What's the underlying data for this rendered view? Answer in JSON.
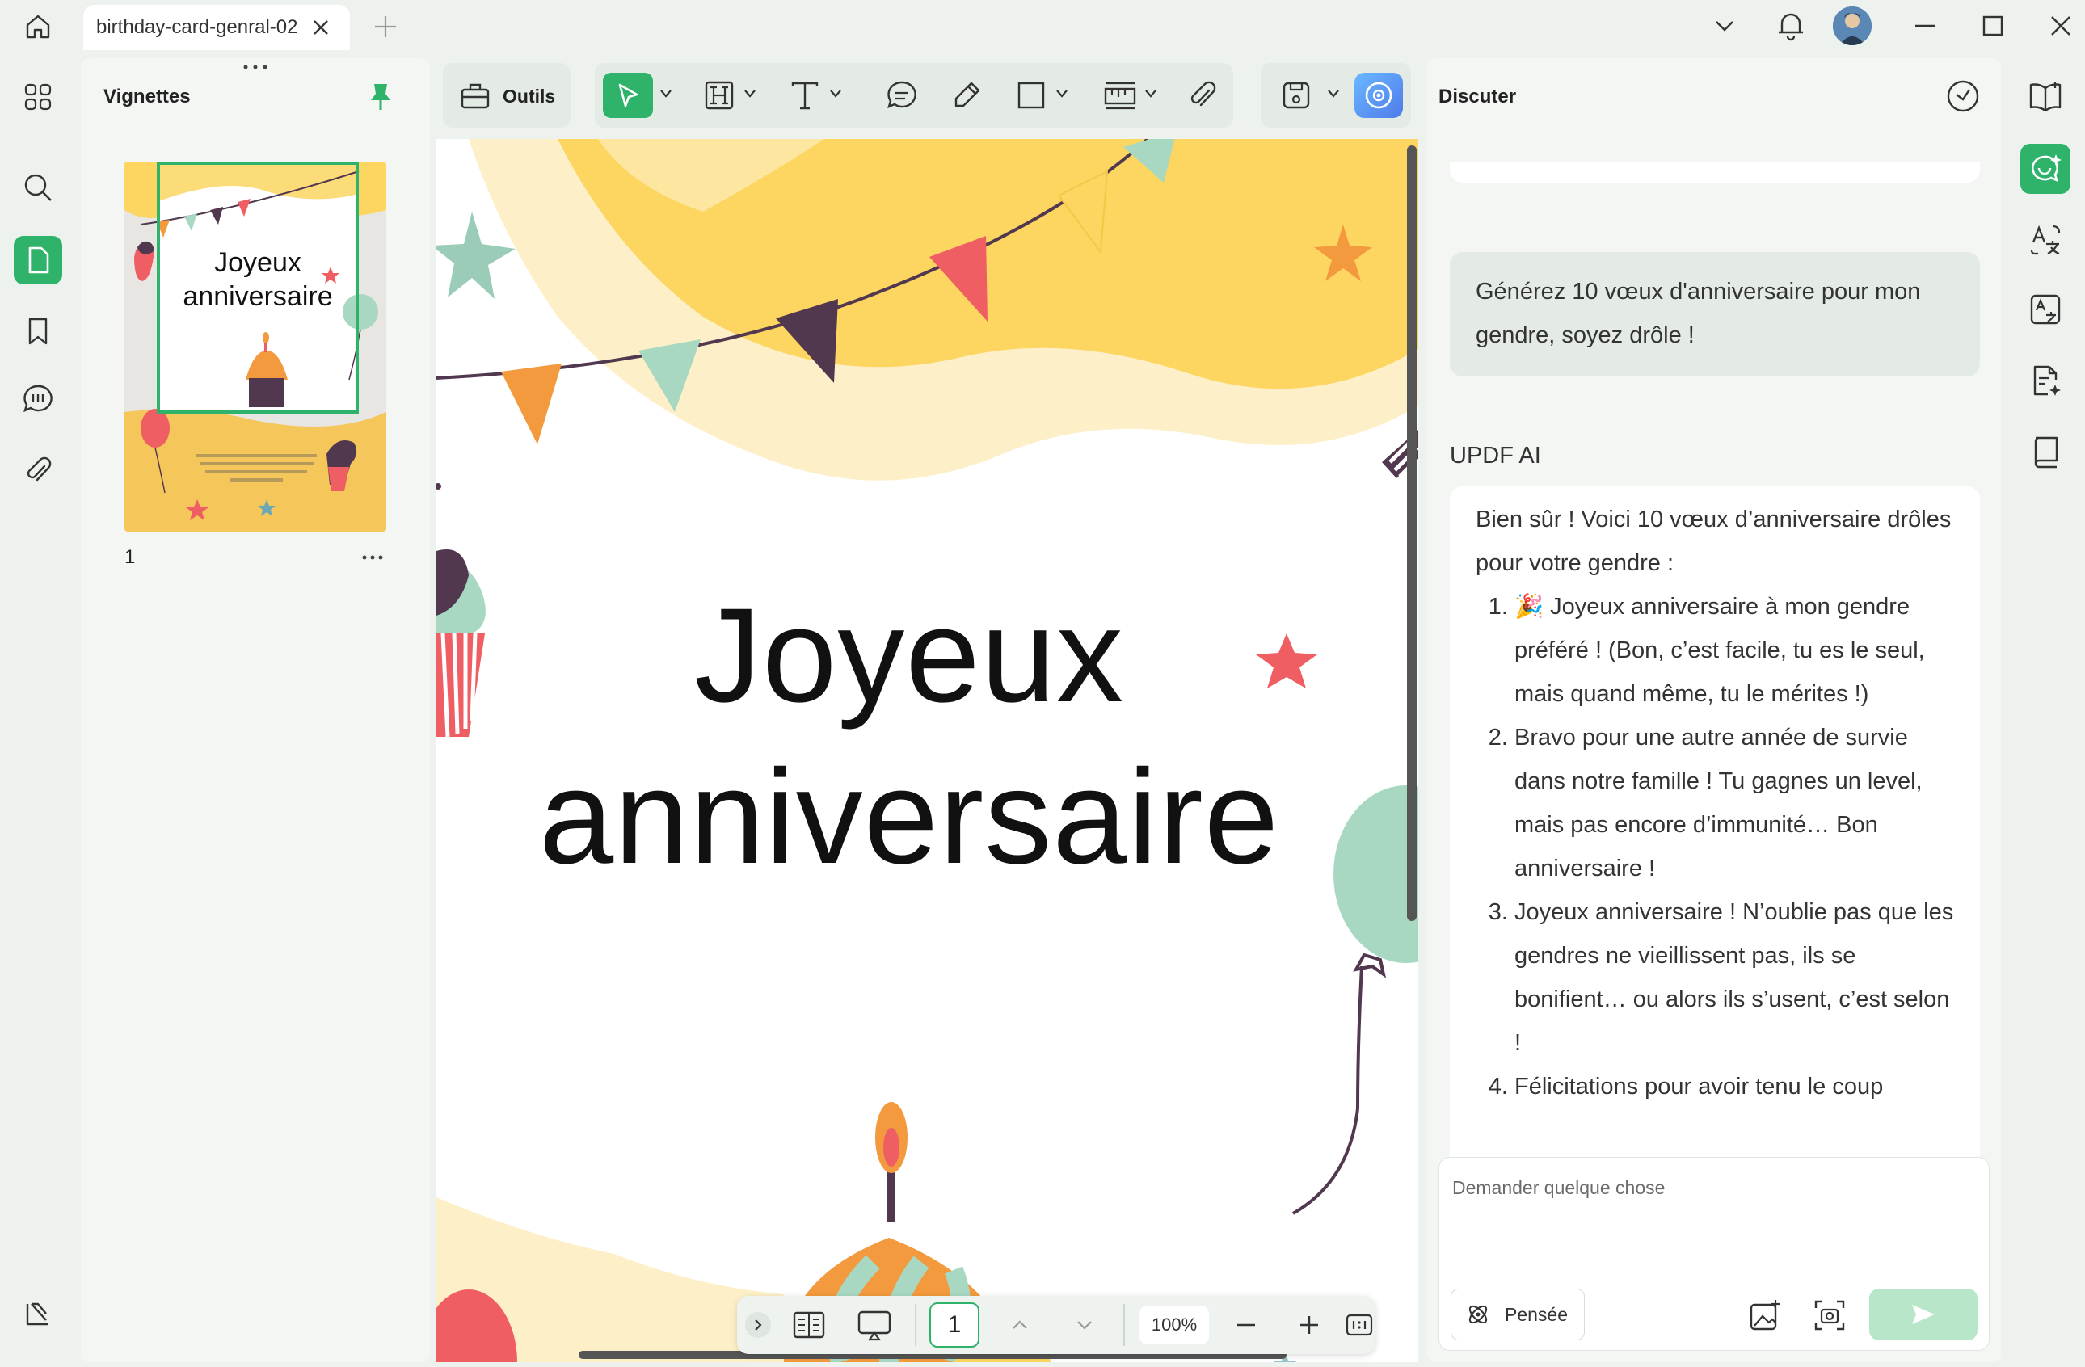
{
  "tab": {
    "title": "birthday-card-genral-02"
  },
  "left_panel": {
    "title": "Vignettes",
    "page_number": "1"
  },
  "toolbar": {
    "tools_label": "Outils"
  },
  "document": {
    "heading_line1": "Joyeux",
    "heading_line2": "anniversaire"
  },
  "page_bar": {
    "current_page": "1",
    "zoom": "100%"
  },
  "chat": {
    "title": "Discuter",
    "user_message": "Générez 10 vœux d'anniversaire pour mon gendre, soyez drôle !",
    "ai_name": "UPDF AI",
    "ai_intro": "Bien sûr ! Voici 10 vœux d’anniversaire drôles pour votre gendre :",
    "ai_items": [
      "🎉 Joyeux anniversaire à mon gendre préféré ! (Bon, c’est facile, tu es le seul, mais quand même, tu le mérites !)",
      "Bravo pour une autre année de survie dans notre famille ! Tu gagnes un level, mais pas encore d’immunité… Bon anniversaire !",
      "Joyeux anniversaire ! N’oublie pas que les gendres ne vieillissent pas, ils se bonifient… ou alors ils s’usent, c’est selon !",
      "Félicitations pour avoir tenu le coup"
    ],
    "input_placeholder": "Demander quelque chose",
    "think_label": "Pensée"
  },
  "colors": {
    "accent": "#2fb36b",
    "yellow": "#fcd660",
    "cream": "#fdf0c8",
    "mint": "#a8d8c2",
    "orange": "#f29a3d",
    "coral": "#ee5e62",
    "plum": "#51384f"
  }
}
